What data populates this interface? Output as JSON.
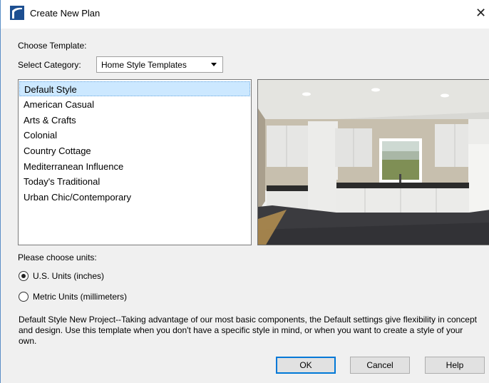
{
  "window": {
    "title": "Create New Plan",
    "close_glyph": "✕"
  },
  "template": {
    "heading": "Choose Template:",
    "category_label": "Select Category:",
    "category_value": "Home Style Templates",
    "items": [
      "Default Style",
      "American Casual",
      "Arts & Crafts",
      "Colonial",
      "Country Cottage",
      "Mediterranean Influence",
      "Today's Traditional",
      "Urban Chic/Contemporary"
    ],
    "selected_index": 0
  },
  "units": {
    "heading": "Please choose units:",
    "options": [
      "U.S. Units (inches)",
      "Metric Units (millimeters)"
    ],
    "selected_index": 0
  },
  "description": "Default Style New Project--Taking advantage of our most basic components, the Default settings give flexibility in concept and design. Use this template when you don't have a specific style in mind, or when you want to create a style of your own.",
  "buttons": {
    "ok": "OK",
    "cancel": "Cancel",
    "help": "Help"
  },
  "colors": {
    "accent": "#0078d7",
    "selection": "#cce8ff",
    "window_border": "#5b8fc7"
  }
}
